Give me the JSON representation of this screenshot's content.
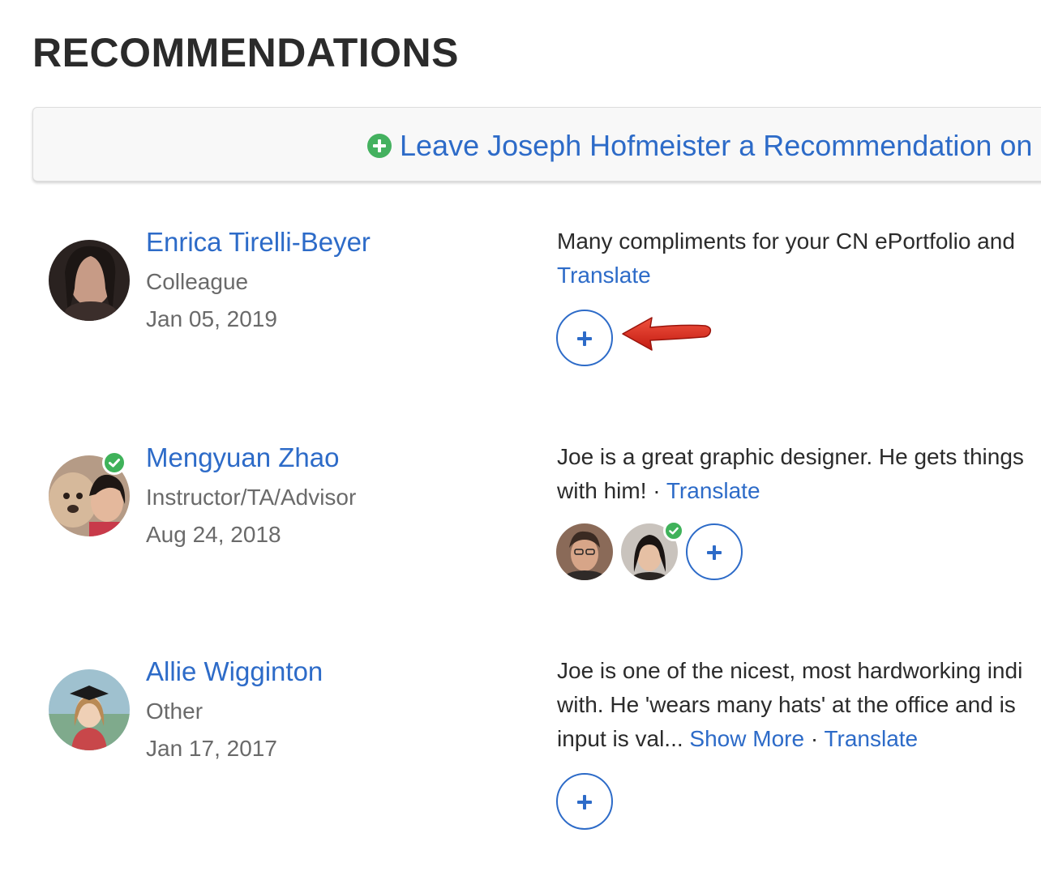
{
  "page": {
    "title": "RECOMMENDATIONS"
  },
  "leave_recommendation": {
    "label": "Leave Joseph Hofmeister a Recommendation on",
    "icon": "plus-circle-icon",
    "icon_color": "#44b15f"
  },
  "colors": {
    "link": "#2d6bc8",
    "verified": "#3fb25a",
    "annotation_arrow": "#d8261b"
  },
  "recommendations": [
    {
      "name": "Enrica Tirelli-Beyer",
      "relationship": "Colleague",
      "date": "Jan 05, 2019",
      "verified": false,
      "lines": [
        "Many compliments for your CN ePortfolio and"
      ],
      "translate_line": "Translate",
      "endorse_button": "plus-icon"
    },
    {
      "name": "Mengyuan Zhao",
      "relationship": "Instructor/TA/Advisor",
      "date": "Aug 24, 2018",
      "verified": true,
      "lines": [
        "Joe is a great graphic designer. He gets things"
      ],
      "last_line_text": "with him!",
      "separator": "·",
      "translate": "Translate",
      "endorser_avatars": 2,
      "endorse_button": "plus-icon"
    },
    {
      "name": "Allie Wigginton",
      "relationship": "Other",
      "date": "Jan 17, 2017",
      "verified": false,
      "lines": [
        "Joe is one of the nicest, most hardworking indi",
        "with. He 'wears many hats' at the office and is"
      ],
      "last_line_text": "input is val...",
      "show_more": "Show More",
      "separator": "·",
      "translate": "Translate",
      "endorse_button": "plus-icon"
    }
  ]
}
